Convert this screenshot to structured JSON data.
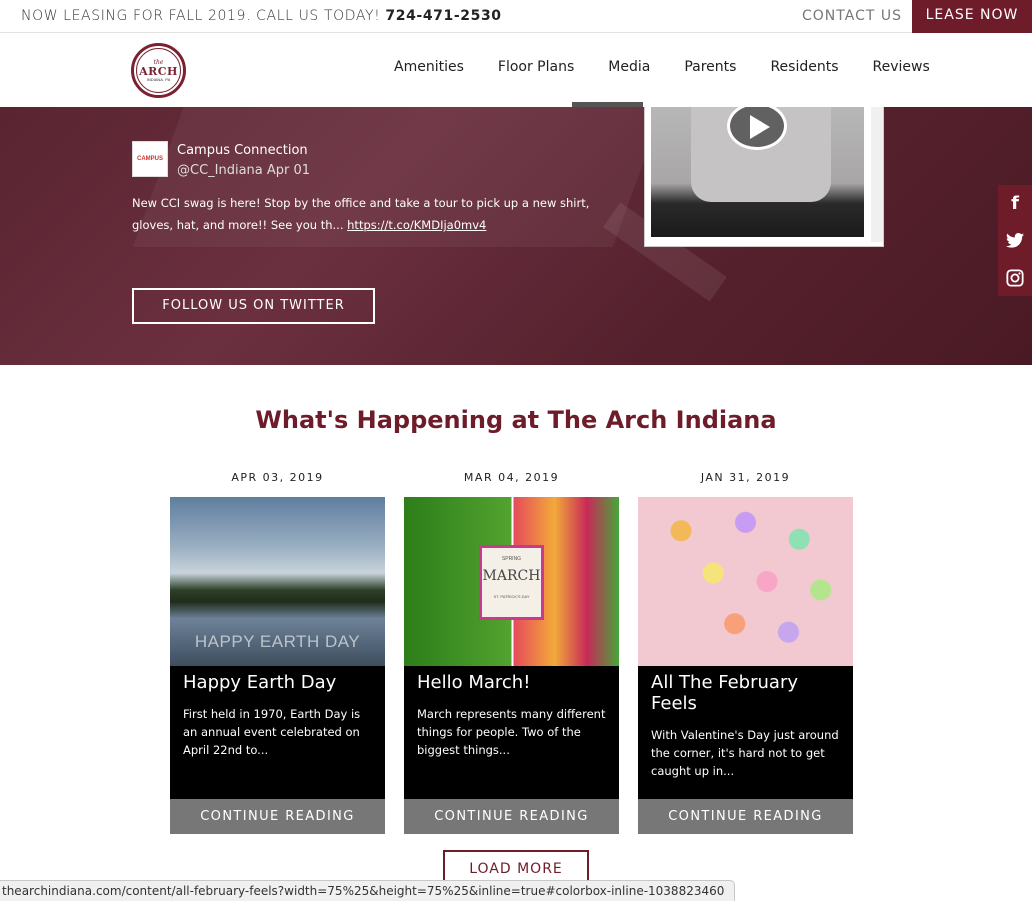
{
  "topbar": {
    "leasing_text": "NOW LEASING FOR FALL 2019. CALL US TODAY!",
    "phone": "724-471-2530",
    "contact_label": "CONTACT US",
    "lease_label": "LEASE NOW"
  },
  "logo": {
    "the": "the",
    "arch": "ARCH",
    "sub": "INDIANA, PA"
  },
  "nav": {
    "items": [
      "Amenities",
      "Floor Plans",
      "Media",
      "Parents",
      "Residents",
      "Reviews"
    ],
    "active": "Media"
  },
  "tweet": {
    "avatar_text": "CAMPUS",
    "name": "Campus Connection",
    "handle": "@CC_Indiana Apr 01",
    "text": "New CCI swag is here! Stop by the office and take a tour to pick up a new shirt, gloves, hat, and more!! See you th...",
    "link": "https://t.co/KMDIja0mv4"
  },
  "follow_label": "FOLLOW US ON TWITTER",
  "social": {
    "facebook_icon": "f",
    "twitter_icon": "t",
    "instagram_icon": "◎"
  },
  "section": {
    "title": "What's Happening at The Arch Indiana"
  },
  "posts": [
    {
      "date": "APR 03, 2019",
      "title": "Happy Earth Day",
      "excerpt": "First held in 1970, Earth Day is an annual event celebrated on April 22nd to...",
      "image_text": "HAPPY EARTH DAY",
      "cta": "CONTINUE READING"
    },
    {
      "date": "MAR 04, 2019",
      "title": "Hello March!",
      "excerpt": "March represents many different things for people. Two of the biggest things...",
      "image_text_top": "SPRING",
      "image_text": "MARCH",
      "image_text_bottom": "ST. PATRICK'S DAY",
      "cta": "CONTINUE READING"
    },
    {
      "date": "JAN 31, 2019",
      "title": "All The February Feels",
      "excerpt": "With Valentine's Day just around the corner, it's hard not to get caught up in...",
      "cta": "CONTINUE READING"
    }
  ],
  "load_more_label": "LOAD MORE",
  "status_url": "thearchindiana.com/content/all-february-feels?width=75%25&height=75%25&inline=true#colorbox-inline-1038823460",
  "colors": {
    "brand": "#6e1c2a",
    "button_gray": "#777777"
  }
}
